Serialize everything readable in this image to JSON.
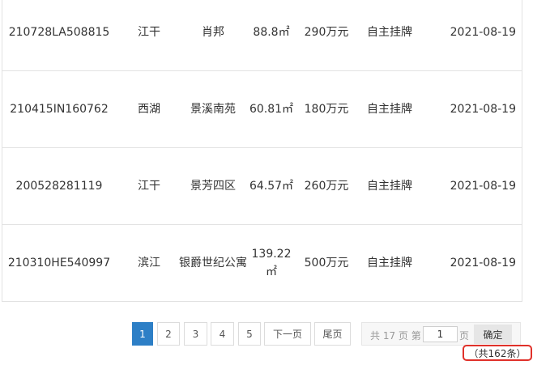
{
  "listings": [
    {
      "id": "210728LA508815",
      "area": "江干",
      "name": "肖邦",
      "size": "88.8㎡",
      "price": "290万元",
      "type": "自主挂牌",
      "date": "2021-08-19"
    },
    {
      "id": "210415IN160762",
      "area": "西湖",
      "name": "景溪南苑",
      "size": "60.81㎡",
      "price": "180万元",
      "type": "自主挂牌",
      "date": "2021-08-19"
    },
    {
      "id": "200528281119",
      "area": "江干",
      "name": "景芳四区",
      "size": "64.57㎡",
      "price": "260万元",
      "type": "自主挂牌",
      "date": "2021-08-19"
    },
    {
      "id": "210310HE540997",
      "area": "滨江",
      "name": "银爵世纪公寓",
      "size": "139.22㎡",
      "price": "500万元",
      "type": "自主挂牌",
      "date": "2021-08-19"
    }
  ],
  "pagination": {
    "pages": [
      "1",
      "2",
      "3",
      "4",
      "5"
    ],
    "active_page": "1",
    "next_label": "下一页",
    "last_label": "尾页",
    "jump": {
      "prefix": "共 17 页 第",
      "value": "1",
      "suffix": "页",
      "confirm_label": "确定"
    },
    "total_text": "（共162条）"
  },
  "colors": {
    "active": "#2d7fc6",
    "highlight": "#e0312a"
  }
}
